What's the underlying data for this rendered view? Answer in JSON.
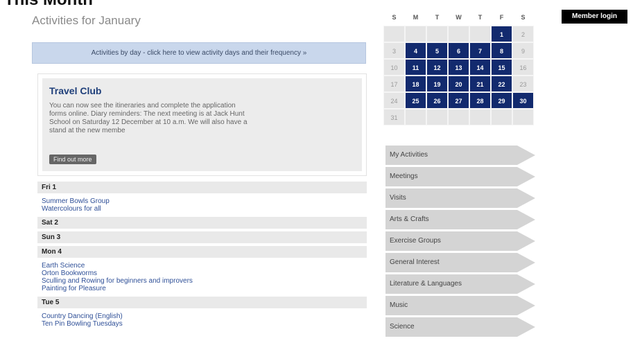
{
  "page": {
    "heading": "This Month",
    "subtitle": "Activities for January"
  },
  "banner": {
    "text": "Activities by day - click here to view activity days and their frequency »"
  },
  "featured": {
    "title": "Travel Club",
    "text": "You can now see the itineraries and complete the application forms online. Diary reminders: The next meeting is at Jack Hunt School on Saturday 12 December at 10 a.m. We will also have a stand at the new membe",
    "button": "Find out more"
  },
  "days": [
    {
      "header": "Fri 1",
      "items": [
        "Summer Bowls Group",
        "Watercolours for all"
      ]
    },
    {
      "header": "Sat 2",
      "items": []
    },
    {
      "header": "Sun 3",
      "items": []
    },
    {
      "header": "Mon 4",
      "items": [
        "Earth Science",
        "Orton Bookworms",
        "Sculling and Rowing for beginners and improvers",
        "Painting for Pleasure"
      ]
    },
    {
      "header": "Tue 5",
      "items": [
        "Country Dancing (English)",
        "Ten Pin Bowling Tuesdays"
      ]
    }
  ],
  "calendar": {
    "weekdays": [
      "S",
      "M",
      "T",
      "W",
      "T",
      "F",
      "S"
    ],
    "weeks": [
      [
        "",
        "",
        "",
        "",
        "",
        "1",
        "2"
      ],
      [
        "3",
        "4",
        "5",
        "6",
        "7",
        "8",
        "9"
      ],
      [
        "10",
        "11",
        "12",
        "13",
        "14",
        "15",
        "16"
      ],
      [
        "17",
        "18",
        "19",
        "20",
        "21",
        "22",
        "23"
      ],
      [
        "24",
        "25",
        "26",
        "27",
        "28",
        "29",
        "30"
      ],
      [
        "31",
        "",
        "",
        "",
        "",
        "",
        ""
      ]
    ],
    "active_days": [
      "1",
      "4",
      "5",
      "6",
      "7",
      "8",
      "11",
      "12",
      "13",
      "14",
      "15",
      "18",
      "19",
      "20",
      "21",
      "22",
      "25",
      "26",
      "27",
      "28",
      "29",
      "30"
    ]
  },
  "menu": {
    "items": [
      "My Activities",
      "Meetings",
      "Visits",
      "Arts & Crafts",
      "Exercise Groups",
      "General Interest",
      "Literature & Languages",
      "Music",
      "Science"
    ]
  },
  "header": {
    "login": "Member login"
  },
  "colors": {
    "accent": "#122a6e",
    "banner": "#c9d7ec",
    "link": "#2e4f97"
  }
}
